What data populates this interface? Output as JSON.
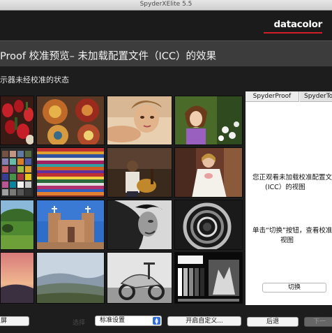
{
  "window": {
    "title": "SpyderXElite 5.5"
  },
  "brand": {
    "name": "datacolor",
    "accent": "#d21f27"
  },
  "header": {
    "title": "Proof 校准预览– 未加载配置文件（ICC）的效果"
  },
  "subheader": {
    "text": "示器未经校准的状态"
  },
  "gallery": {
    "images": [
      {
        "name": "strawberries-photo"
      },
      {
        "name": "painted-plates-photo"
      },
      {
        "name": "woman-portrait-photo"
      },
      {
        "name": "girl-flowers-photo"
      },
      {
        "name": "color-checker-chart"
      },
      {
        "name": "striped-fabric-photo"
      },
      {
        "name": "guitar-player-photo"
      },
      {
        "name": "bride-photo"
      },
      {
        "name": "green-landscape-photo"
      },
      {
        "name": "adobe-church-photo"
      },
      {
        "name": "bw-woman-photo"
      },
      {
        "name": "spiral-staircase-photo"
      },
      {
        "name": "sunset-sky-photo"
      },
      {
        "name": "hills-landscape-photo"
      },
      {
        "name": "bw-scooter-photo"
      },
      {
        "name": "grayscale-test-photo"
      }
    ]
  },
  "sidebar": {
    "tabs": [
      {
        "label": "SpyderProof"
      },
      {
        "label": "SpyderTo"
      }
    ],
    "info_line1": "您正观看未加载校准配置文",
    "info_line2": "(ICC）的视图",
    "hint_line1": "单击“切换”按钮，查看校准",
    "hint_line2": "视图",
    "switch_label": "切换"
  },
  "footer": {
    "left_button": "屏",
    "select_label": "选择",
    "select_value": "标准设置",
    "custom_button": "开启自定义...",
    "back_button": "后退",
    "next_button": "下一"
  }
}
